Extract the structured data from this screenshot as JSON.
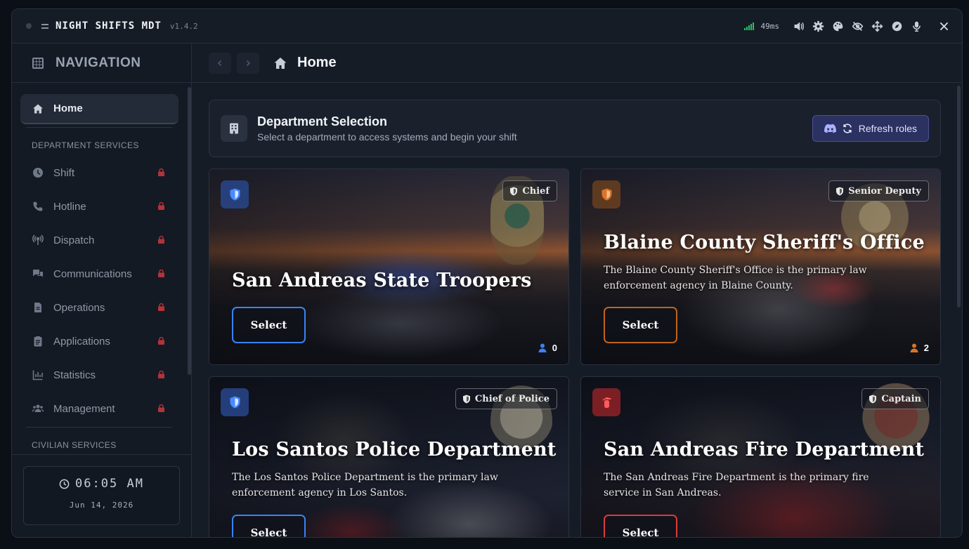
{
  "app": {
    "title": "NIGHT SHIFTS MDT",
    "version": "v1.4.2",
    "ping": "49ms"
  },
  "sidebar": {
    "heading": "NAVIGATION",
    "home_label": "Home",
    "section_department": "DEPARTMENT SERVICES",
    "items": [
      {
        "label": "Shift",
        "icon": "clock-icon",
        "locked": true
      },
      {
        "label": "Hotline",
        "icon": "phone-icon",
        "locked": true
      },
      {
        "label": "Dispatch",
        "icon": "broadcast-icon",
        "locked": true
      },
      {
        "label": "Communications",
        "icon": "chat-icon",
        "locked": true
      },
      {
        "label": "Operations",
        "icon": "document-icon",
        "locked": true
      },
      {
        "label": "Applications",
        "icon": "clipboard-icon",
        "locked": true
      },
      {
        "label": "Statistics",
        "icon": "chart-icon",
        "locked": true
      },
      {
        "label": "Management",
        "icon": "users-icon",
        "locked": true
      }
    ],
    "section_civilian": "CIVILIAN SERVICES",
    "clock": {
      "time": "06:05 AM",
      "date": "Jun 14, 2026"
    }
  },
  "main": {
    "title": "Home",
    "dept_selection": {
      "title": "Department Selection",
      "subtitle": "Select a department to access systems and begin your shift",
      "refresh_label": "Refresh roles"
    },
    "cards": [
      {
        "name": "San Andreas State Troopers",
        "description": "",
        "rank": "Chief",
        "select_label": "Select",
        "count": "0",
        "accent": "#3b82f6"
      },
      {
        "name": "Blaine County Sheriff's Office",
        "description": "The Blaine County Sheriff's Office is the primary law enforcement agency in Blaine County.",
        "rank": "Senior Deputy",
        "select_label": "Select",
        "count": "2",
        "accent": "#c2631b"
      },
      {
        "name": "Los Santos Police Department",
        "description": "The Los Santos Police Department is the primary law enforcement agency in Los Santos.",
        "rank": "Chief of Police",
        "select_label": "Select",
        "count": "",
        "accent": "#3b82f6"
      },
      {
        "name": "San Andreas Fire Department",
        "description": "The San Andreas Fire Department is the primary fire service in San Andreas.",
        "rank": "Captain",
        "select_label": "Select",
        "count": "",
        "accent": "#dc3a3a"
      }
    ]
  }
}
